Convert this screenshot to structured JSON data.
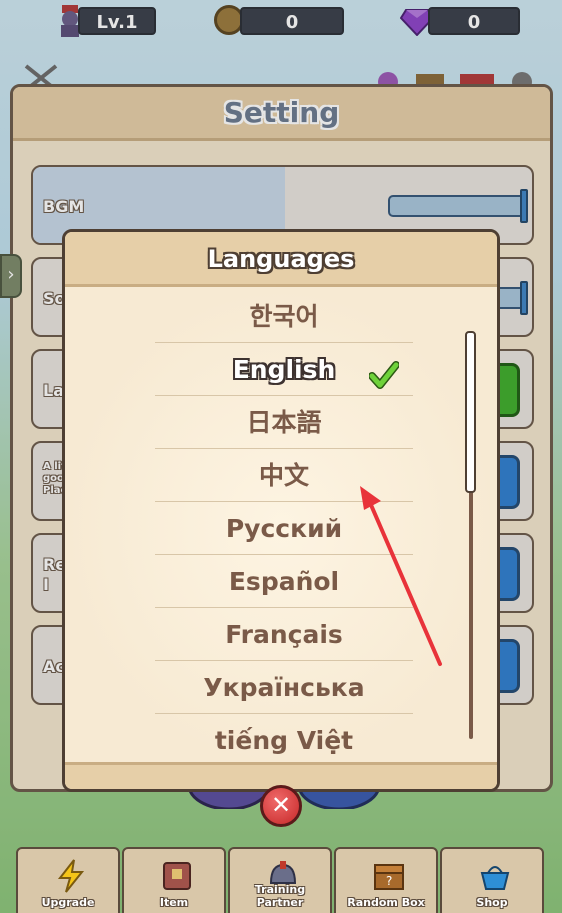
{
  "topbar": {
    "level": "Lv.1",
    "coins": "0",
    "gems": "0"
  },
  "setting": {
    "title": "Setting",
    "rows": [
      {
        "label": "BGM",
        "slider_value": 1.0
      },
      {
        "label": "So"
      },
      {
        "label": "La"
      },
      {
        "label": "A lit\ngoo\nPlac"
      },
      {
        "label": "Re\nI"
      },
      {
        "label": "Ac"
      }
    ]
  },
  "modal": {
    "title": "Languages",
    "languages": [
      "한국어",
      "English",
      "日本語",
      "中文",
      "Русский",
      "Español",
      "Français",
      "Українська",
      "tiếng Việt"
    ],
    "selected": "English",
    "close_label": "✕"
  },
  "bottom_nav": [
    {
      "label": "Upgrade",
      "icon": "lightning-icon"
    },
    {
      "label": "Item",
      "icon": "scroll-icon"
    },
    {
      "label": "Training Partner",
      "icon": "helmet-icon"
    },
    {
      "label": "Random Box",
      "icon": "chest-icon"
    },
    {
      "label": "Shop",
      "icon": "basket-icon"
    }
  ],
  "colors": {
    "panel": "#f3e6cd",
    "header": "#e6cfa8",
    "border": "#4e3f33",
    "check": "#5bbf2a",
    "arrow": "#e8333a",
    "close": "#c62828"
  }
}
